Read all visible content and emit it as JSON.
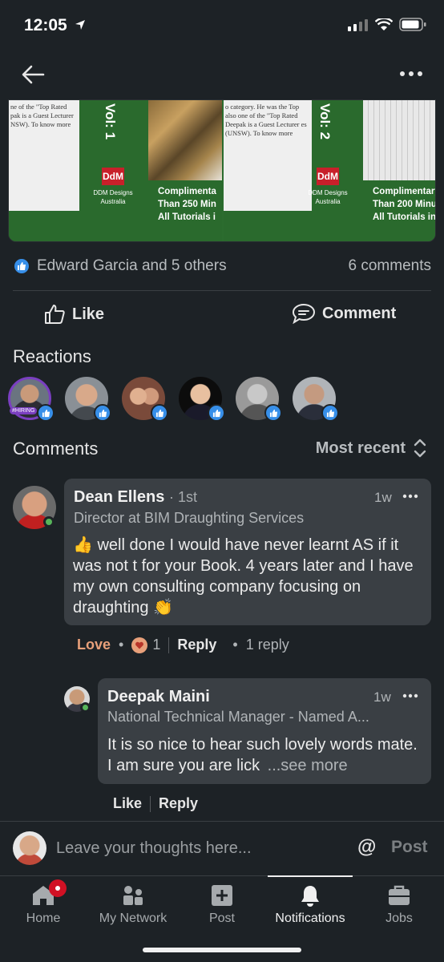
{
  "status_bar": {
    "time": "12:05"
  },
  "hero": {
    "book1": {
      "blurb": "ne of the \"Top Rated pak is a Guest Lecturer NSW). To know more",
      "volume": "Vol: 1",
      "logo": "DdM",
      "brand": "DDM Designs Australia",
      "promo_line1": "Complimenta",
      "promo_line2": "Than 250 Min",
      "promo_line3": "All Tutorials i"
    },
    "book2": {
      "blurb": "o category. He was the Top also one of the \"Top Rated Deepak is a Guest Lecturer es (UNSW). To know more",
      "volume": "Vol: 2",
      "logo": "DdM",
      "brand": "DDM Designs Australia",
      "promo_line1": "Complimentary",
      "promo_line2": "Than 200 Minut",
      "promo_line3": "All Tutorials in th"
    }
  },
  "post_stats": {
    "reactions_text": "Edward Garcia and 5 others",
    "comments_text": "6 comments"
  },
  "actions": {
    "like_label": "Like",
    "comment_label": "Comment"
  },
  "reactions_section": {
    "title": "Reactions",
    "hiring_badge": "#HIRING"
  },
  "comments_section": {
    "title": "Comments",
    "sort_label": "Most recent"
  },
  "comments": [
    {
      "name": "Dean Ellens",
      "degree": "· 1st",
      "title": "Director at BIM Draughting Services",
      "time": "1w",
      "body": "well done I would have never learnt AS if it was not t for your Book. 4 years later and I have my own consulting company focusing on draughting",
      "emoji_start": "👍",
      "emoji_end": "👏",
      "love_label": "Love",
      "reaction_count": "1",
      "reply_label": "Reply",
      "replies_label": "1 reply"
    },
    {
      "name": "Deepak Maini",
      "title": "National Technical Manager - Named A...",
      "time": "1w",
      "body": "It is so nice to hear such lovely words mate. I am sure you are lick",
      "see_more": "...see more",
      "like_label": "Like",
      "reply_label": "Reply"
    }
  ],
  "compose": {
    "placeholder": "Leave your thoughts here...",
    "at_label": "@",
    "post_label": "Post"
  },
  "tabs": [
    {
      "label": "Home",
      "icon": "home-icon"
    },
    {
      "label": "My Network",
      "icon": "network-icon"
    },
    {
      "label": "Post",
      "icon": "post-icon"
    },
    {
      "label": "Notifications",
      "icon": "bell-icon"
    },
    {
      "label": "Jobs",
      "icon": "briefcase-icon"
    }
  ],
  "colors": {
    "background": "#1d2226",
    "like_blue": "#378fe9",
    "card": "#3a3f44",
    "love": "#e8a07a",
    "badge_red": "#d11124",
    "online_green": "#57b45a"
  }
}
